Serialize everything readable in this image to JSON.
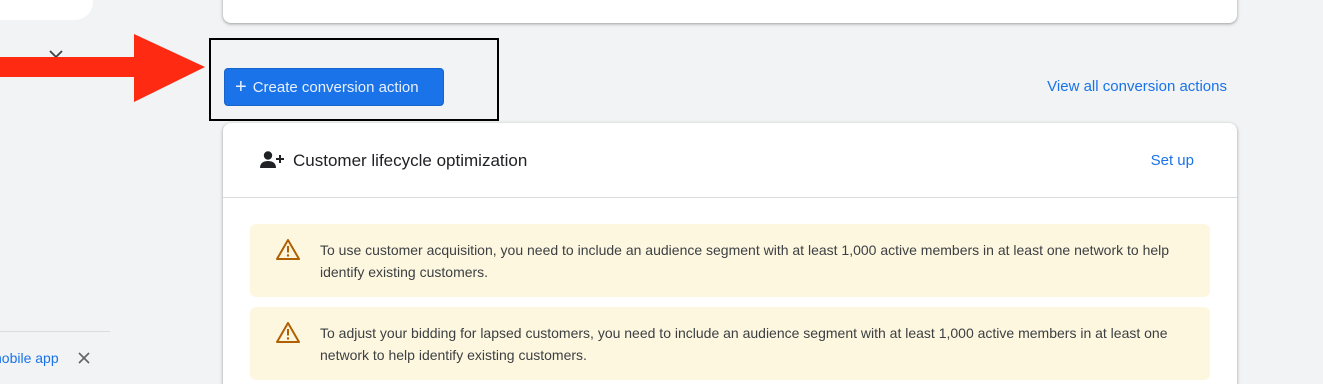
{
  "sidebar": {
    "promo_text": "nobile app",
    "close_icon": "close-icon",
    "chevron_icon": "chevron-down-icon"
  },
  "toolbar": {
    "create_label": "Create conversion action",
    "create_icon": "plus-icon",
    "view_all_label": "View all conversion actions"
  },
  "lifecycle_card": {
    "title": "Customer lifecycle optimization",
    "icon": "person-add-icon",
    "setup_label": "Set up",
    "warnings": [
      {
        "icon": "warning-icon",
        "text": "To use customer acquisition, you need to include an audience segment with at least 1,000 active members in at least one network to help identify existing customers."
      },
      {
        "icon": "warning-icon",
        "text": "To adjust your bidding for lapsed customers, you need to include an audience segment with at least 1,000 active members in at least one network to help identify existing customers."
      }
    ]
  },
  "colors": {
    "accent": "#1a73e8",
    "warning_bg": "#fef7e0",
    "warning_icon": "#b06000",
    "annotation_arrow": "#ff2a12"
  }
}
